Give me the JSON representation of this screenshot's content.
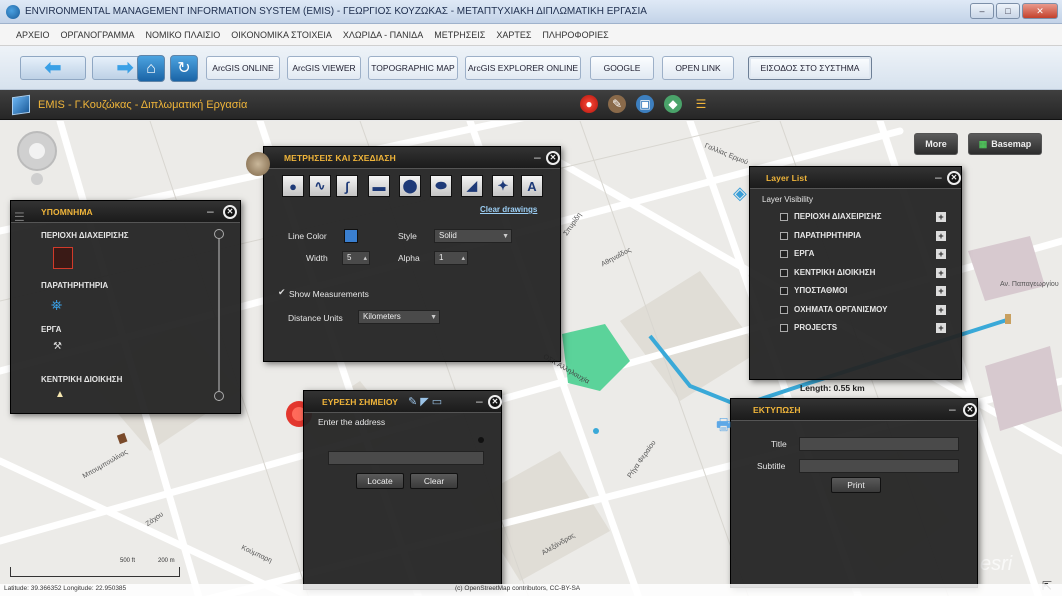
{
  "window": {
    "title": "ENVIRONMENTAL MANAGEMENT INFORMATION SYSTEM (EMIS) - ΓΕΩΡΓΙΟΣ ΚΟΥΖΩΚΑΣ - ΜΕΤΑΠΤΥΧΙΑΚΗ ΔΙΠΛΩΜΑΤΙΚΗ ΕΡΓΑΣΙΑ"
  },
  "menu": [
    "ΑΡΧΕΙΟ",
    "ΟΡΓΑΝΟΓΡΑΜΜΑ",
    "ΝΟΜΙΚΟ ΠΛΑΙΣΙΟ",
    "ΟΙΚΟΝΟΜΙΚΑ ΣΤΟΙΧΕΙΑ",
    "ΧΛΩΡΙΔΑ - ΠΑΝΙΔΑ",
    "ΜΕΤΡΗΣΕΙΣ",
    "ΧΑΡΤΕΣ",
    "ΠΛΗΡΟΦΟΡΙΕΣ"
  ],
  "toolbar": {
    "buttons": [
      "ArcGIS ONLINE",
      "ArcGIS VIEWER",
      "TOPOGRAPHIC MAP",
      "ArcGIS EXPLORER ONLINE",
      "GOOGLE",
      "OPEN LINK",
      "ΕΙΣΟΔΟΣ ΣΤΟ ΣΥΣΤΗΜΑ"
    ]
  },
  "app": {
    "title": "EMIS - Γ.Κουζώκας - Διπλωματική Εργασία"
  },
  "map": {
    "more_label": "More",
    "basemap_label": "Basemap",
    "length_label": "Length: 0.55 km",
    "scale_label": "500 ft",
    "scale_label_m": "200 m",
    "coords": "Latitude: 39.366352  Longitude: 22.950385",
    "attribution": "(c) OpenStreetMap contributors, CC-BY-SA",
    "watermark": "esri",
    "street_labels": [
      "Γαλλίας Ερμού",
      "Αθηναΐδος",
      "Σπυρίδη",
      "ΟΣΚ Αλληλουχία",
      "Μπουμπουλίνας",
      "Ζάχου",
      "Κούμπαρη",
      "Ρήγα Φεραίου",
      "Αλεξάνδρας",
      "Αν. Παπαγεωργίου"
    ]
  },
  "legend": {
    "title": "ΥΠΟΜΝΗΜΑ",
    "items": [
      "ΠΕΡΙΟΧΗ ΔΙΑΧΕΙΡΙΣΗΣ",
      "ΠΑΡΑΤΗΡΗΤΗΡΙΑ",
      "ΕΡΓΑ",
      "ΚΕΝΤΡΙΚΗ ΔΙΟΙΚΗΣΗ"
    ]
  },
  "draw": {
    "title": "ΜΕΤΡΗΣΕΙΣ ΚΑΙ ΣΧΕΔΙΑΣΗ",
    "clear_label": "Clear drawings",
    "line_color_label": "Line Color",
    "style_label": "Style",
    "style_value": "Solid",
    "width_label": "Width",
    "width_value": "5",
    "alpha_label": "Alpha",
    "alpha_value": "1",
    "show_measurements_label": "Show Measurements",
    "distance_units_label": "Distance Units",
    "distance_units_value": "Kilometers",
    "line_color": "#3a7fd0",
    "tools": [
      "point-tool",
      "polyline-tool",
      "freehand-tool",
      "rectangle-tool",
      "circle-tool",
      "ellipse-tool",
      "polygon-tool",
      "freehand-polygon-tool",
      "text-tool"
    ],
    "text_tool_glyph": "A"
  },
  "layers": {
    "title": "Layer List",
    "visibility_label": "Layer Visibility",
    "items": [
      "ΠΕΡΙΟΧΗ ΔΙΑΧΕΙΡΙΣΗΣ",
      "ΠΑΡΑΤΗΡΗΤΗΡΙΑ",
      "ΕΡΓΑ",
      "ΚΕΝΤΡΙΚΗ ΔΙΟΙΚΗΣΗ",
      "ΥΠΟΣΤΑΘΜΟΙ",
      "ΟΧΗΜΑΤΑ ΟΡΓΑΝΙΣΜΟΥ",
      "PROJECTS"
    ]
  },
  "find": {
    "title": "ΕΥΡΕΣΗ ΣΗΜΕΙΟΥ",
    "prompt": "Enter the address",
    "address_value": "",
    "locate_label": "Locate",
    "clear_label": "Clear"
  },
  "print": {
    "title": "ΕΚΤΥΠΩΣΗ",
    "title_label": "Title",
    "subtitle_label": "Subtitle",
    "title_value": "",
    "subtitle_value": "",
    "print_label": "Print"
  },
  "colors": {
    "accent": "#f0b53a",
    "panel_bg": "#242424",
    "measure_line": "#3aa9d8",
    "park": "#5bd39a"
  }
}
